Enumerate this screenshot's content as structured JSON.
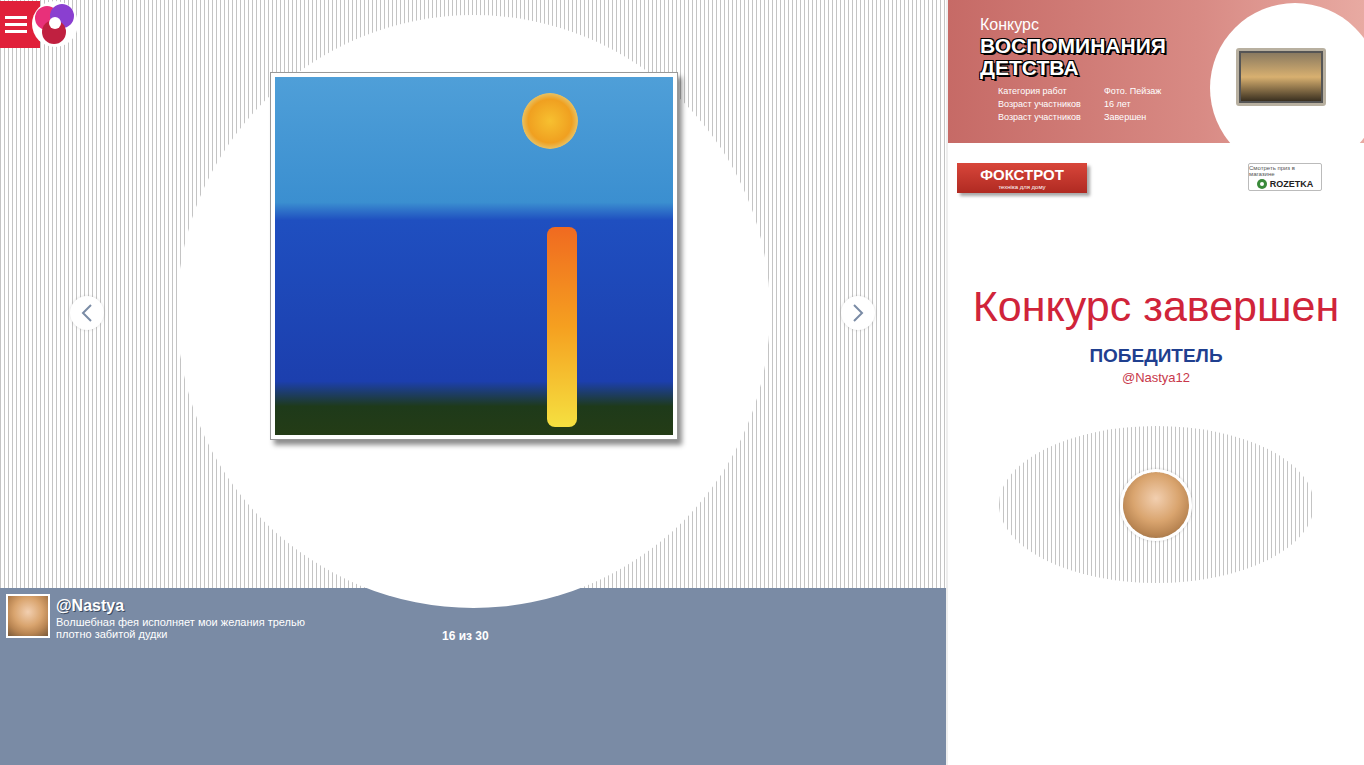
{
  "gallery": {
    "position": "16 из 30"
  },
  "entry": {
    "author": "@Nastya",
    "caption": "Волшебная фея исполняет мои желания трелью плотно забитой дудки"
  },
  "contest": {
    "label": "Конкурс",
    "title": "ВОСПОМИНАНИЯ ДЕТСТВА",
    "details": [
      {
        "label": "Категория работ",
        "value": "Фото. Пейзаж"
      },
      {
        "label": "Возраст участников",
        "value": "16 лет"
      },
      {
        "label": "Возраст участников",
        "value": "Завершен"
      }
    ]
  },
  "shops": [
    {
      "name": "ФОКСТРОТ",
      "tagline": "техніка для дому",
      "kind": "foxtrot"
    },
    {
      "name": "ROZETKA",
      "tagline": "Смотреть приз в магазине",
      "kind": "rozetka"
    }
  ],
  "status": "Конкурс завершен",
  "winner": {
    "label": "ПОБЕДИТЕЛЬ",
    "user": "@Nastya12"
  }
}
